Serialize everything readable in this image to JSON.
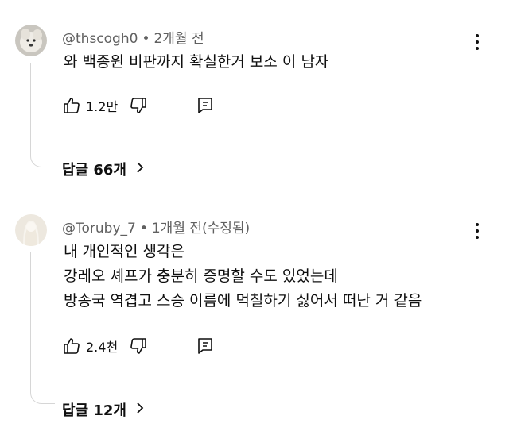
{
  "comments": [
    {
      "author": "@thscogh0",
      "time": "2개월 전",
      "lines": [
        "와 백종원 비판까지 확실한거 보소 이 남자"
      ],
      "likes": "1.2만",
      "replies": "답글 66개"
    },
    {
      "author": "@Toruby_7",
      "time": "1개월 전(수정됨)",
      "lines": [
        "내 개인적인 생각은",
        "강레오 셰프가 충분히 증명할 수도 있었는데",
        "방송국 역겹고 스승 이름에 먹칠하기 싫어서 떠난 거 같음"
      ],
      "likes": "2.4천",
      "replies": "답글 12개"
    }
  ],
  "separator": "•",
  "icons": {
    "like": "thumbs-up-icon",
    "dislike": "thumbs-down-icon",
    "reply": "reply-comment-icon",
    "menu": "more-vertical-icon",
    "chevron": "chevron-right-icon"
  },
  "colors": {
    "text": "#0f0f0f",
    "meta": "#606060",
    "thread": "#d6d6d6"
  }
}
